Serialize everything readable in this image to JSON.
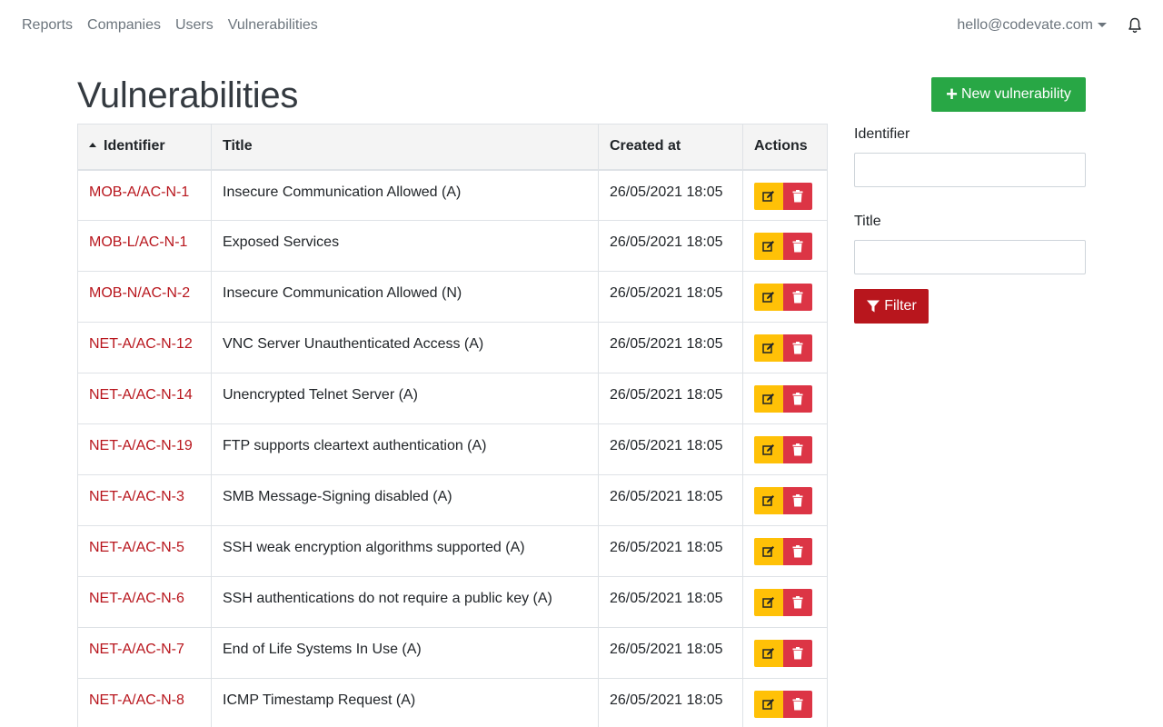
{
  "nav": {
    "links": [
      "Reports",
      "Companies",
      "Users",
      "Vulnerabilities"
    ],
    "user_email": "hello@codevate.com",
    "icons": {
      "user_menu_caret": "caret-down-icon",
      "notifications": "bell-icon"
    }
  },
  "page": {
    "title": "Vulnerabilities",
    "new_button_label": "New vulnerability",
    "new_button_icon": "plus-icon"
  },
  "table": {
    "columns": [
      "Identifier",
      "Title",
      "Created at",
      "Actions"
    ],
    "sort": {
      "column": "Identifier",
      "direction": "asc"
    },
    "rows": [
      {
        "identifier": "MOB-A/AC-N-1",
        "title": "Insecure Communication Allowed (A)",
        "created_at": "26/05/2021 18:05"
      },
      {
        "identifier": "MOB-L/AC-N-1",
        "title": "Exposed Services",
        "created_at": "26/05/2021 18:05"
      },
      {
        "identifier": "MOB-N/AC-N-2",
        "title": "Insecure Communication Allowed (N)",
        "created_at": "26/05/2021 18:05"
      },
      {
        "identifier": "NET-A/AC-N-12",
        "title": "VNC Server Unauthenticated Access (A)",
        "created_at": "26/05/2021 18:05"
      },
      {
        "identifier": "NET-A/AC-N-14",
        "title": "Unencrypted Telnet Server (A)",
        "created_at": "26/05/2021 18:05"
      },
      {
        "identifier": "NET-A/AC-N-19",
        "title": "FTP supports cleartext authentication (A)",
        "created_at": "26/05/2021 18:05"
      },
      {
        "identifier": "NET-A/AC-N-3",
        "title": "SMB Message-Signing disabled (A)",
        "created_at": "26/05/2021 18:05"
      },
      {
        "identifier": "NET-A/AC-N-5",
        "title": "SSH weak encryption algorithms supported (A)",
        "created_at": "26/05/2021 18:05"
      },
      {
        "identifier": "NET-A/AC-N-6",
        "title": "SSH authentications do not require a public key (A)",
        "created_at": "26/05/2021 18:05"
      },
      {
        "identifier": "NET-A/AC-N-7",
        "title": "End of Life Systems In Use (A)",
        "created_at": "26/05/2021 18:05"
      },
      {
        "identifier": "NET-A/AC-N-8",
        "title": "ICMP Timestamp Request (A)",
        "created_at": "26/05/2021 18:05"
      }
    ],
    "action_icons": {
      "edit": "edit-icon",
      "delete": "trash-icon"
    }
  },
  "filter": {
    "identifier_label": "Identifier",
    "identifier_value": "",
    "title_label": "Title",
    "title_value": "",
    "button_label": "Filter",
    "button_icon": "funnel-icon"
  },
  "colors": {
    "link_red": "#b8161d",
    "success_green": "#28a745",
    "warning_yellow": "#ffc107",
    "danger_red": "#dc3545",
    "filter_red": "#b8161d",
    "nav_gray": "#6c757d",
    "title_dark": "#343a40"
  }
}
